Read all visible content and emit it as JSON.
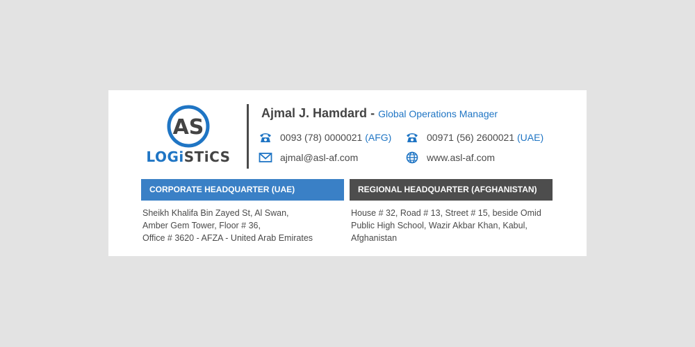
{
  "brand": {
    "logo_letters": "AS",
    "logo_word_1": "LOGi",
    "logo_word_2": "STiCS",
    "accent_color": "#1f75c4",
    "dark_color": "#444444"
  },
  "person": {
    "name": "Ajmal J. Hamdard",
    "separator": " - ",
    "role": "Global Operations Manager"
  },
  "contacts": {
    "phone_afg": {
      "icon": "phone-icon",
      "number": "0093 (78) 0000021",
      "tag": "(AFG)"
    },
    "phone_uae": {
      "icon": "phone-icon",
      "number": "00971 (56) 2600021",
      "tag": "(UAE)"
    },
    "email": {
      "icon": "envelope-icon",
      "value": "ajmal@asl-af.com"
    },
    "website": {
      "icon": "globe-icon",
      "value": "www.asl-af.com"
    }
  },
  "headquarters": {
    "corporate": {
      "title": "CORPORATE HEADQUARTER (UAE)",
      "color": "#3a80c6",
      "lines": [
        "Sheikh Khalifa Bin Zayed St, Al Swan,",
        "Amber Gem Tower, Floor # 36,",
        "Office # 3620 - AFZA - United Arab Emirates"
      ]
    },
    "regional": {
      "title": "REGIONAL HEADQUARTER (AFGHANISTAN)",
      "color": "#4d4d4d",
      "lines": [
        "House # 32, Road # 13, Street # 15, beside Omid",
        "Public High School, Wazir Akbar Khan, Kabul,",
        "Afghanistan"
      ]
    }
  }
}
